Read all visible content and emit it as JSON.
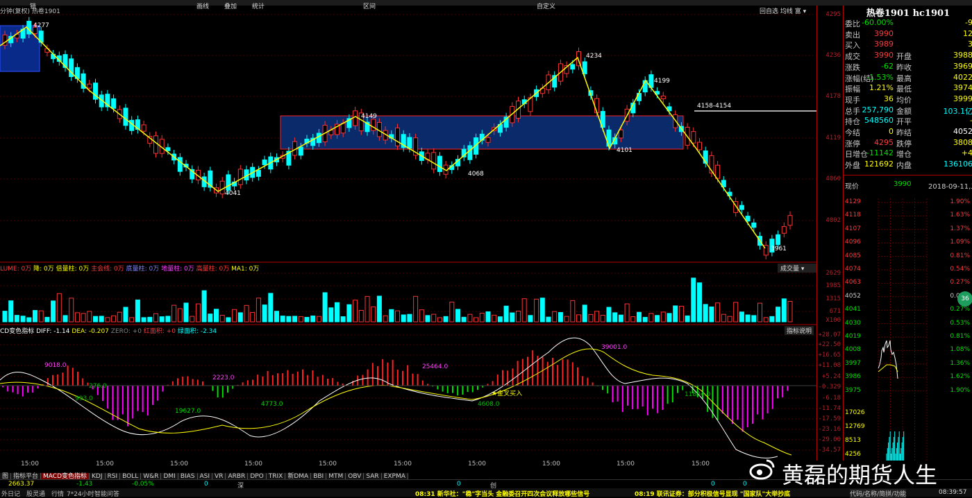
{
  "menu": {
    "items": [
      "锁",
      "画线",
      "叠加",
      "统计",
      "区间",
      "自定义"
    ]
  },
  "chart_header": {
    "period": "分钟(复权)",
    "name": "热卷1901"
  },
  "toolbar": {
    "buttons": [
      "回自选",
      "均线",
      "富",
      "▾"
    ]
  },
  "price_axis": [
    "4295",
    "4236",
    "4178",
    "4119",
    "4060",
    "4002"
  ],
  "price_annotations": {
    "p1": "4277",
    "p2": "4041",
    "p3": "4149",
    "p4": "4068",
    "p5": "4234",
    "p6": "4101",
    "p7": "4199",
    "p8": "3961",
    "hline": "4158-4154"
  },
  "volume_legend": {
    "title": "LUME: 0万",
    "i1": "降: 0万",
    "i2": "倍量柱: 0万",
    "i3": "主会线: 0万",
    "i4": "底量柱: 0万",
    "i5": "地量柱: 0万",
    "i6": "高量柱: 0万",
    "i7": "MA1: 0万",
    "select": "成交量"
  },
  "volume_axis": [
    "2629",
    "1985",
    "1315",
    "671",
    "X100"
  ],
  "macd_legend": {
    "title": "CD变色指标",
    "diff": "DIFF: -1.14",
    "dea": "DEA: -0.207",
    "zero": "ZERO: +0",
    "red": "红面积: +0",
    "green": "绿面积: -2.34",
    "help": "指标说明"
  },
  "macd_axis": [
    "+28.07",
    "+22.50",
    "+16.65",
    "+11.08",
    "+5.24",
    "-0.329",
    "-6.18",
    "-11.74",
    "-17.59",
    "-23.16",
    "-29.00",
    "-34.57"
  ],
  "macd_annotations": {
    "a1": "9018.0",
    "a2": "276.0",
    "a3": "993.0",
    "a4": "19627.0",
    "a5": "2223.0",
    "a6": "4773.0",
    "a7": "25464.0",
    "a8": "金叉买入",
    "a9": "4608.0",
    "a10": "39001.0",
    "a11": "11804.0"
  },
  "time_ticks": [
    "15:00",
    "15:00",
    "15:00",
    "15:00",
    "15:00",
    "15:00",
    "15:00",
    "15:00",
    "15:00",
    "15:00"
  ],
  "indicator_tabs": [
    "图",
    "指标平台",
    "MACD变色指标",
    "KDJ",
    "RSI",
    "BOLL",
    "W&R",
    "DMI",
    "BIAS",
    "ASI",
    "VR",
    "ARBR",
    "DPO",
    "TRIX",
    "新DMA",
    "BBI",
    "MTM",
    "OBV",
    "SAR",
    "EXPMA"
  ],
  "quote": {
    "title": "热卷1901 hc1901",
    "rows": [
      {
        "l": "委比",
        "v1": "-60.00%",
        "l2": "",
        "v2": "-9"
      },
      {
        "l": "卖出",
        "v1": "3990",
        "l2": "",
        "v2": "12"
      },
      {
        "l": "买入",
        "v1": "3989",
        "l2": "",
        "v2": "3"
      },
      {
        "l": "成交",
        "v1": "3990",
        "l2": "开盘",
        "v2": "3988"
      },
      {
        "l": "涨跌",
        "v1": "-62",
        "l2": "昨收",
        "v2": "3969"
      },
      {
        "l": "涨幅(结)",
        "v1": "-1.53%",
        "l2": "最高",
        "v2": "4022"
      },
      {
        "l": "振幅",
        "v1": "1.21%",
        "l2": "最低",
        "v2": "3974"
      },
      {
        "l": "现手",
        "v1": "36",
        "l2": "均价",
        "v2": "3999"
      },
      {
        "l": "总手",
        "v1": "257,790",
        "l2": "金额",
        "v2": "103.1亿"
      },
      {
        "l": "持仓",
        "v1": "548560",
        "l2": "开平",
        "v2": "-"
      },
      {
        "l": "今结",
        "v1": "0",
        "l2": "昨结",
        "v2": "4052"
      },
      {
        "l": "涨停",
        "v1": "4295",
        "l2": "跌停",
        "v2": "3808"
      },
      {
        "l": "日增仓",
        "v1": "-11142",
        "l2": "增仓",
        "v2": "+4"
      },
      {
        "l": "外盘",
        "v1": "121692",
        "l2": "内盘",
        "v2": "136106"
      }
    ],
    "now_label": "现价",
    "now_value": "3990",
    "now_date": "2018-09-11,二"
  },
  "mini_chart": {
    "left_axis": [
      "4129",
      "4118",
      "4107",
      "4096",
      "4085",
      "4074",
      "4063",
      "4052",
      "4041",
      "4030",
      "4019",
      "4008",
      "3997",
      "3986",
      "3975"
    ],
    "right_axis": [
      "1.90%",
      "1.63%",
      "1.37%",
      "1.09%",
      "0.81%",
      "0.54%",
      "0.27%",
      "0.00%",
      "0.27%",
      "0.53%",
      "0.81%",
      "1.08%",
      "1.36%",
      "1.62%",
      "1.90%"
    ],
    "vol_axis": [
      "17026",
      "12769",
      "8513",
      "4256"
    ],
    "badge": "36"
  },
  "status": {
    "index_val": "2663.37",
    "index_chg": "-1.43",
    "index_pct": "-0.05%",
    "zero1": "0",
    "shen": "深",
    "zero2": "0",
    "chuang": "创",
    "zero3": "0",
    "zero4": "0",
    "news1": "08:31 新华社：\"稳\"字当头 金融委召开四次会议释放哪些信号",
    "news2": "08:19 联讯证券：部分积极信号显现 \"国家队\"大举抄底",
    "right_text": "代码/名称/简拼/功能",
    "clock": "08:39:57",
    "bottom_items": [
      "外日记",
      "股灵通",
      "行情",
      "7*24小时",
      "智能问答"
    ]
  },
  "watermark": "黄磊的期货人生",
  "colors": {
    "up": "#ff3232",
    "down": "#00ffff",
    "zigzag": "#ffff00",
    "box": "#0a2a6a",
    "macd_pos": "#ff2020",
    "macd_neg": "#ff00ff",
    "macd_green": "#00e000"
  }
}
